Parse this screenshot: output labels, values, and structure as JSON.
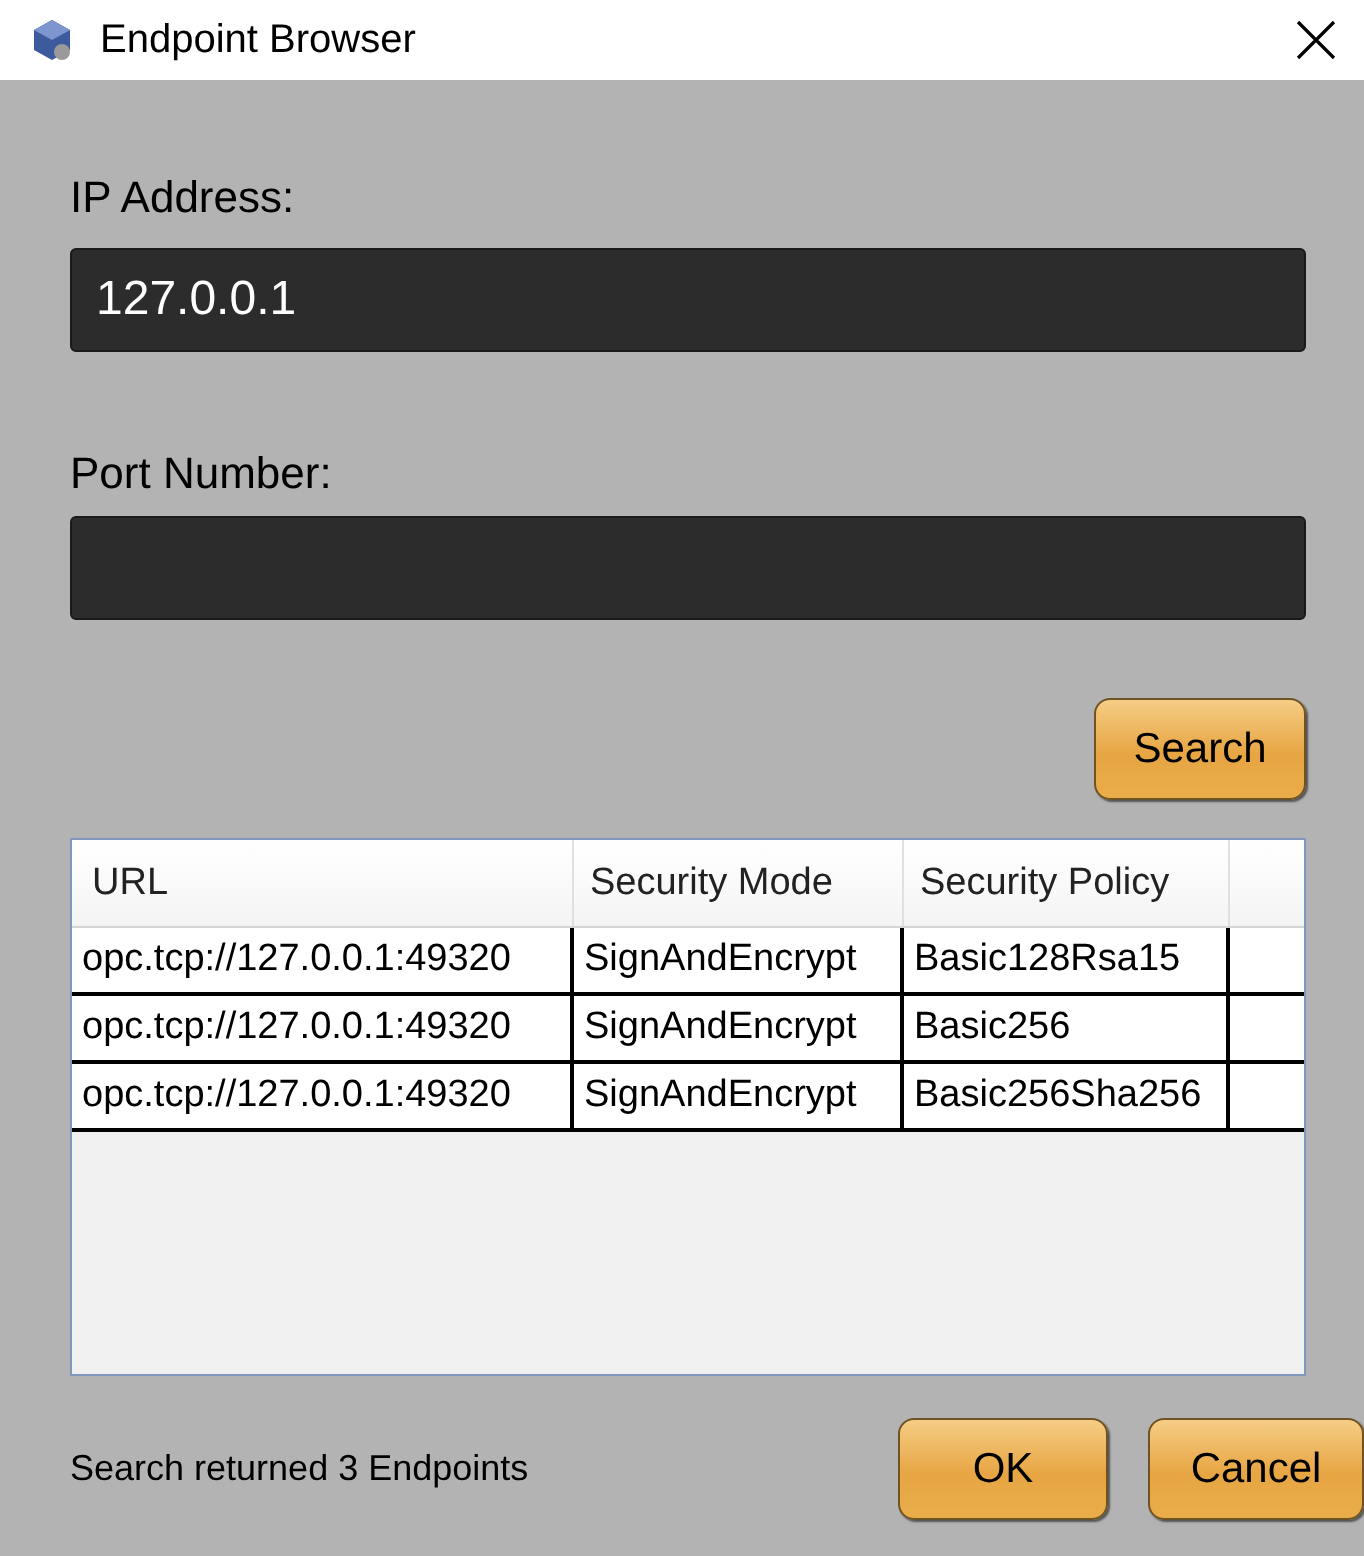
{
  "window": {
    "title": "Endpoint Browser"
  },
  "ip_address": {
    "label": "IP Address:",
    "value": "127.0.0.1"
  },
  "port_number": {
    "label": "Port Number:"
  },
  "search_button": "Search",
  "table": {
    "columns": [
      "URL",
      "Security Mode",
      "Security Policy"
    ],
    "rows": [
      {
        "cells": [
          "opc.tcp://127.0.0.1:49320",
          "SignAndEncrypt",
          "Basic128Rsa15"
        ],
        "selected": false
      },
      {
        "cells": [
          "opc.tcp://127.0.0.1:49320",
          "SignAndEncrypt",
          "Basic256"
        ],
        "selected": false
      },
      {
        "cells": [
          "opc.tcp://127.0.0.1:49320",
          "SignAndEncrypt",
          "Basic256Sha256"
        ],
        "selected": false
      }
    ]
  },
  "status": "Search returned 3 Endpoints",
  "buttons": [
    "OK",
    "Cancel"
  ]
}
